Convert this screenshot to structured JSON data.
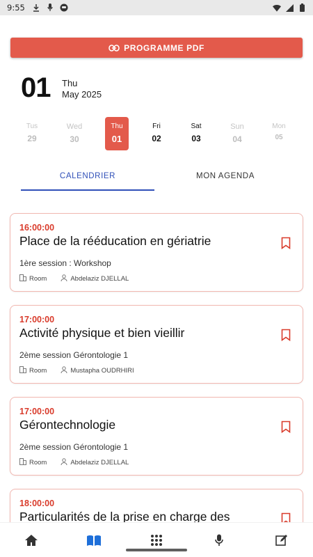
{
  "status_bar": {
    "time": "9:55",
    "left_icons": [
      "download-icon",
      "microphone-icon",
      "app-status-icon"
    ],
    "right_icons": [
      "wifi-icon",
      "signal-icon",
      "battery-icon"
    ]
  },
  "pdf_button": {
    "label": "PROGRAMME PDF",
    "icon": "link-icon",
    "color": "#e35a4b"
  },
  "date_header": {
    "day": "01",
    "weekday": "Thu",
    "month_year": "May 2025"
  },
  "day_strip": [
    {
      "name": "Tus",
      "num": "29",
      "state": "past"
    },
    {
      "name": "Wed",
      "num": "30",
      "state": "past"
    },
    {
      "name": "Thu",
      "num": "01",
      "state": "selected"
    },
    {
      "name": "Fri",
      "num": "02",
      "state": "normal"
    },
    {
      "name": "Sat",
      "num": "03",
      "state": "normal"
    },
    {
      "name": "Sun",
      "num": "04",
      "state": "future"
    },
    {
      "name": "Mon",
      "num": "05",
      "state": "future"
    }
  ],
  "tabs": [
    {
      "label": "CALENDRIER",
      "active": true
    },
    {
      "label": "MON AGENDA",
      "active": false
    }
  ],
  "sessions": [
    {
      "time": "16:00:00",
      "title": "Place de la rééducation en gériatrie",
      "session": "1ère session : Workshop",
      "room": "Room",
      "speaker": "Abdelaziz DJELLAL"
    },
    {
      "time": "17:00:00",
      "title": "Activité physique et bien vieillir",
      "session": "2ème session Gérontologie 1",
      "room": "Room",
      "speaker": "Mustapha OUDRHIRI"
    },
    {
      "time": "17:00:00",
      "title": "Gérontechnologie",
      "session": "2ème session Gérontologie 1",
      "room": "Room",
      "speaker": "Abdelaziz DJELLAL"
    },
    {
      "time": "18:00:00",
      "title": "Particularités de la prise en charge des",
      "session": "",
      "room": "",
      "speaker": ""
    }
  ],
  "bottom_nav": [
    {
      "icon": "home-icon"
    },
    {
      "icon": "book-icon",
      "active": true
    },
    {
      "icon": "apps-grid-icon"
    },
    {
      "icon": "microphone-icon"
    },
    {
      "icon": "edit-icon"
    }
  ],
  "colors": {
    "accent": "#e35a4b",
    "time_red": "#d93b2b",
    "tab_blue": "#2f4fb8",
    "nav_blue": "#1e6fd9"
  }
}
